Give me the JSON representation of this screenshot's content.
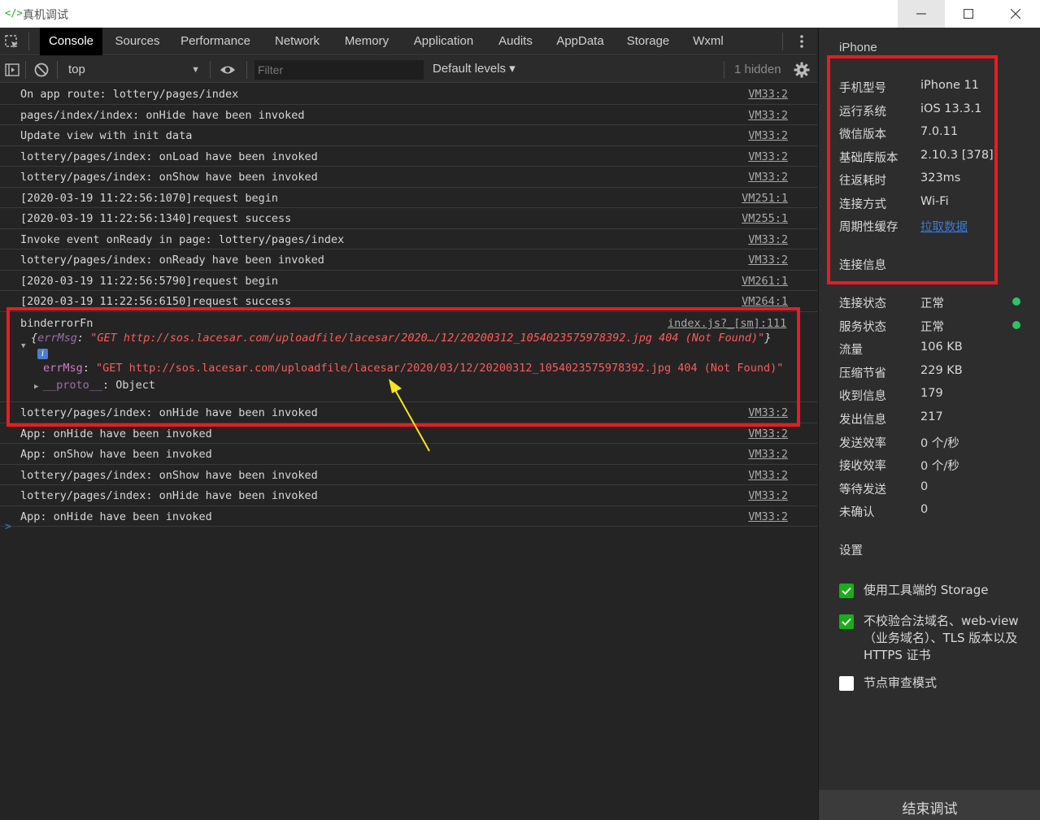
{
  "window": {
    "title": "真机调试",
    "logo_text": "</>"
  },
  "tabs": [
    "Console",
    "Sources",
    "Performance",
    "Network",
    "Memory",
    "Application",
    "Audits",
    "AppData",
    "Storage",
    "Wxml"
  ],
  "filterbar": {
    "context": "top",
    "filter_placeholder": "Filter",
    "levels": "Default levels ▾",
    "hidden": "1 hidden"
  },
  "logs_before": [
    {
      "msg": "On app route: lottery/pages/index",
      "src": "VM33:2"
    },
    {
      "msg": "pages/index/index: onHide have been invoked",
      "src": "VM33:2"
    },
    {
      "msg": "Update view with init data",
      "src": "VM33:2"
    },
    {
      "msg": "lottery/pages/index: onLoad have been invoked",
      "src": "VM33:2"
    },
    {
      "msg": "lottery/pages/index: onShow have been invoked",
      "src": "VM33:2"
    },
    {
      "msg": "[2020-03-19 11:22:56:1070]request begin",
      "src": "VM251:1"
    },
    {
      "msg": "[2020-03-19 11:22:56:1340]request success",
      "src": "VM255:1"
    },
    {
      "msg": "Invoke event onReady in page: lottery/pages/index",
      "src": "VM33:2"
    },
    {
      "msg": "lottery/pages/index: onReady have been invoked",
      "src": "VM33:2"
    },
    {
      "msg": "[2020-03-19 11:22:56:5790]request begin",
      "src": "VM261:1"
    },
    {
      "msg": "[2020-03-19 11:22:56:6150]request success",
      "src": "VM264:1"
    }
  ],
  "error_entry": {
    "fn": "binderrorFn",
    "src": "index.js?_[sm]:111",
    "obj_open": "{",
    "obj_key": "errMsg",
    "obj_sep": ": ",
    "obj_value": "\"GET http://sos.lacesar.com/uploadfile/lacesar/2020…/12/20200312_1054023575978392.jpg 404 (Not Found)\"",
    "obj_close": "}",
    "info": "i",
    "child_key": "errMsg",
    "child_sep": ": ",
    "child_value": "\"GET http://sos.lacesar.com/uploadfile/lacesar/2020/03/12/20200312_1054023575978392.jpg 404 (Not Found)\"",
    "proto_key": "__proto__",
    "proto_value": ": Object"
  },
  "logs_after": [
    {
      "msg": "lottery/pages/index: onHide have been invoked",
      "src": "VM33:2"
    },
    {
      "msg": "App: onHide have been invoked",
      "src": "VM33:2"
    },
    {
      "msg": "App: onShow have been invoked",
      "src": "VM33:2"
    },
    {
      "msg": "lottery/pages/index: onShow have been invoked",
      "src": "VM33:2"
    },
    {
      "msg": "lottery/pages/index: onHide have been invoked",
      "src": "VM33:2"
    },
    {
      "msg": "App: onHide have been invoked",
      "src": "VM33:2"
    }
  ],
  "prompt": ">",
  "sidebar": {
    "title": "iPhone",
    "device": [
      {
        "k": "手机型号",
        "v": "iPhone 11"
      },
      {
        "k": "运行系统",
        "v": "iOS 13.3.1"
      },
      {
        "k": "微信版本",
        "v": "7.0.11"
      },
      {
        "k": "基础库版本",
        "v": "2.10.3 [378]"
      },
      {
        "k": "往返耗时",
        "v": "323ms"
      },
      {
        "k": "连接方式",
        "v": "Wi-Fi"
      },
      {
        "k": "周期性缓存",
        "v": "拉取数据"
      }
    ],
    "conn_title": "连接信息",
    "conn": [
      {
        "k": "连接状态",
        "v": "正常"
      },
      {
        "k": "服务状态",
        "v": "正常"
      },
      {
        "k": "流量",
        "v": "106 KB"
      },
      {
        "k": "压缩节省",
        "v": "229 KB"
      },
      {
        "k": "收到信息",
        "v": "179"
      },
      {
        "k": "发出信息",
        "v": "217"
      },
      {
        "k": "发送效率",
        "v": "0 个/秒"
      },
      {
        "k": "接收效率",
        "v": "0 个/秒"
      },
      {
        "k": "等待发送",
        "v": "0"
      },
      {
        "k": "未确认",
        "v": "0"
      }
    ],
    "settings_title": "设置",
    "settings": [
      {
        "label": "使用工具端的 Storage",
        "checked": true
      },
      {
        "label": "不校验合法域名、web-view（业务域名）、TLS 版本以及 HTTPS 证书",
        "checked": true
      },
      {
        "label": "节点审查模式",
        "checked": false
      }
    ],
    "end_button": "结束调试"
  },
  "colors": {
    "status_ok": "#2fc264",
    "highlight_box": "#e81c24",
    "checkbox_on": "#1aad19",
    "link": "#3a7bd5"
  }
}
